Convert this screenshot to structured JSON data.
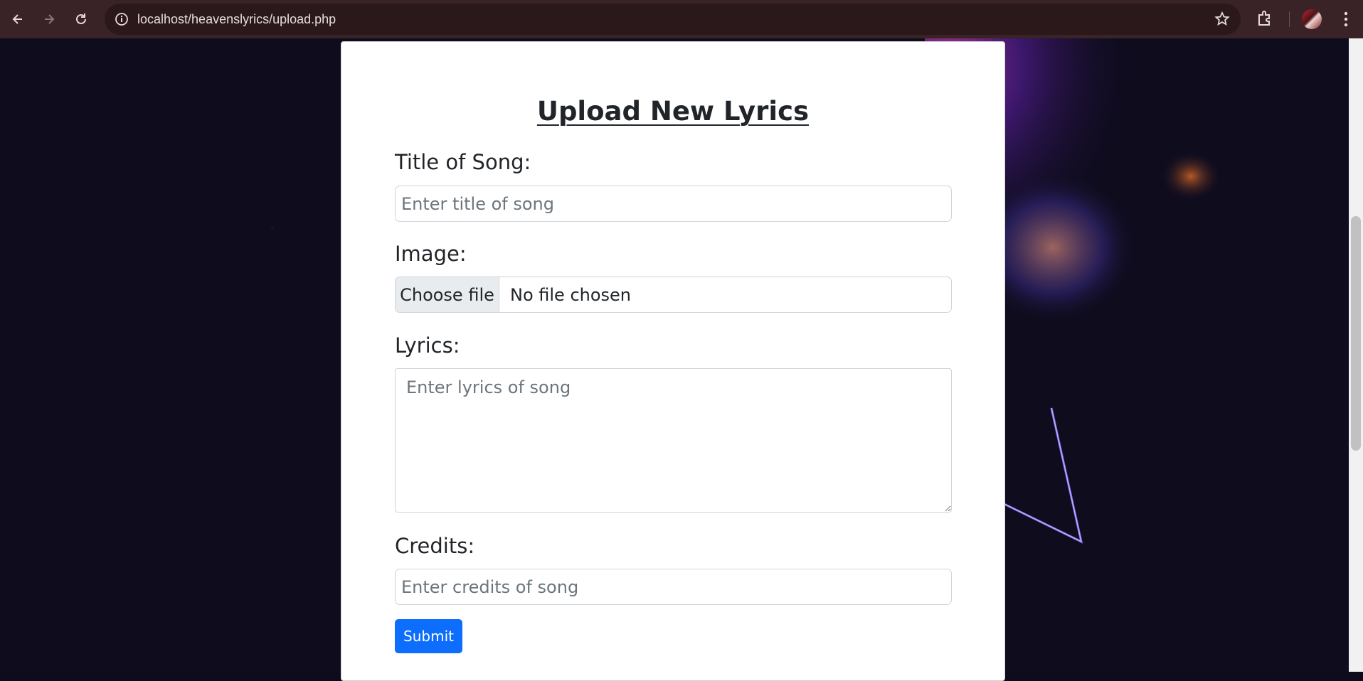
{
  "browser": {
    "url": "localhost/heavenslyrics/upload.php"
  },
  "form": {
    "heading": "Upload New Lyrics",
    "title_label": "Title of Song:",
    "title_placeholder": "Enter title of song",
    "image_label": "Image:",
    "choose_file_label": "Choose file",
    "no_file_text": "No file chosen",
    "lyrics_label": "Lyrics:",
    "lyrics_placeholder": "Enter lyrics of song",
    "credits_label": "Credits:",
    "credits_placeholder": "Enter credits of song",
    "submit_label": "Submit"
  },
  "colors": {
    "chrome": "#3a2326",
    "primary": "#0d6efd",
    "page_bg": "#0f0c1e"
  }
}
